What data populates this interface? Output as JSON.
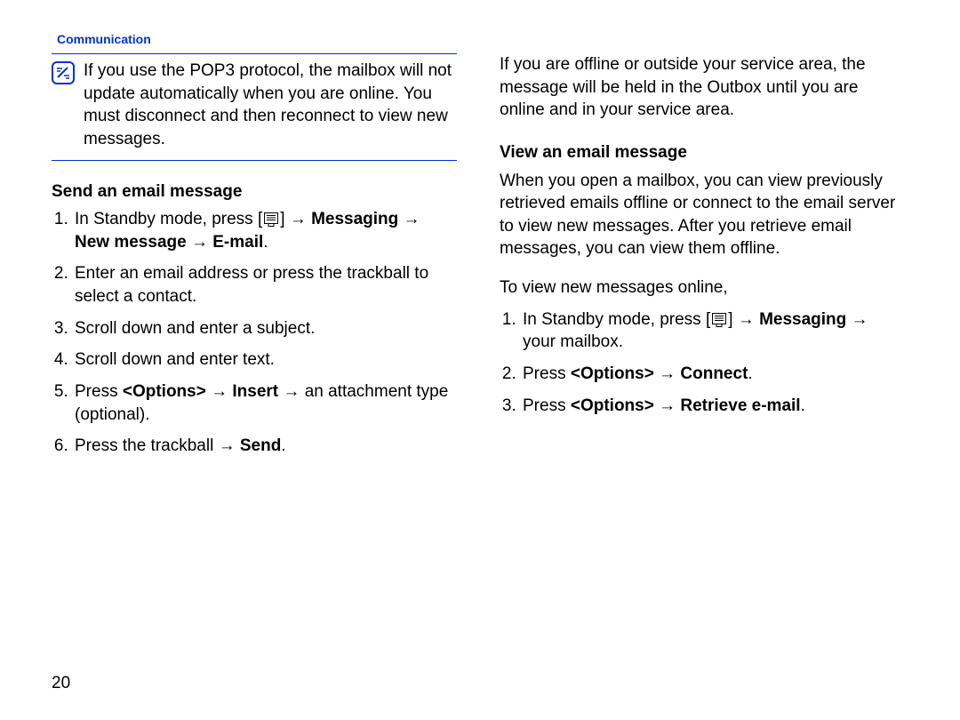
{
  "header": {
    "section": "Communication"
  },
  "pageNumber": "20",
  "note": "If you use the POP3 protocol, the mailbox will not update automatically when you are online. You must disconnect and then reconnect to view new messages.",
  "left": {
    "title": "Send an email message",
    "step1_prefix": "In Standby mode, press [",
    "step1_suffix": "] → ",
    "step1_bold": "Messaging → New message → E-mail",
    "step1_end": ".",
    "step2": "Enter an email address or press the trackball to select a contact.",
    "step3": "Scroll down and enter a subject.",
    "step4": "Scroll down and enter text.",
    "step5_a": "Press ",
    "step5_b1": "<Options>",
    "step5_c": " → ",
    "step5_b2": "Insert",
    "step5_d": " → an attachment type (optional).",
    "step6_a": "Press the trackball → ",
    "step6_b": "Send",
    "step6_c": "."
  },
  "right": {
    "intro": "If you are offline or outside your service area, the message will be held in the Outbox until you are online and in your service area.",
    "title": "View an email message",
    "para": "When you open a mailbox, you can view previously retrieved emails offline or connect to the email server to view new messages. After you retrieve email messages, you can view them offline.",
    "lead": "To view new messages online,",
    "step1_prefix": "In Standby mode, press [",
    "step1_suffix": "] → ",
    "step1_bold": "Messaging",
    "step1_end": " → your mailbox.",
    "step2_a": "Press ",
    "step2_b1": "<Options>",
    "step2_c": " → ",
    "step2_b2": "Connect",
    "step2_d": ".",
    "step3_a": "Press ",
    "step3_b1": "<Options>",
    "step3_c": " → ",
    "step3_b2": "Retrieve e-mail",
    "step3_d": "."
  }
}
